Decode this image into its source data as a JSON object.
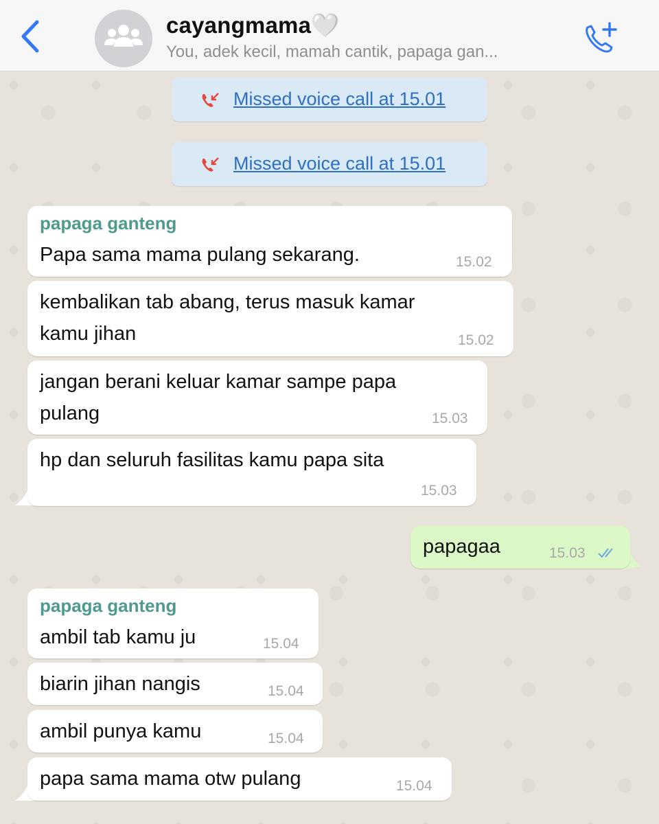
{
  "header": {
    "back_icon": "chevron-left-icon",
    "avatar_icon": "group-icon",
    "title": "cayangmama",
    "title_emoji": "🤍",
    "subtitle": "You, adek kecil, mamah cantik, papaga gan...",
    "call_icon": "add-call-icon"
  },
  "system_messages": [
    {
      "icon": "missed-call-icon",
      "text": "Missed voice call at 15.01"
    },
    {
      "icon": "missed-call-icon",
      "text": "Missed voice call at 15.01"
    }
  ],
  "messages": [
    {
      "sender": "papaga ganteng",
      "lines": [
        "Papa sama mama pulang sekarang."
      ],
      "time": "15.02"
    },
    {
      "lines": [
        "kembalikan tab abang, terus masuk kamar",
        "kamu jihan"
      ],
      "time": "15.02"
    },
    {
      "lines": [
        "jangan berani keluar kamar sampe papa",
        "pulang"
      ],
      "time": "15.03"
    },
    {
      "lines": [
        "hp dan seluruh fasilitas kamu papa sita"
      ],
      "time": "15.03"
    },
    {
      "lines": [
        "papagaa"
      ],
      "time": "15.03",
      "outgoing": true,
      "status_icon": "double-check-icon"
    },
    {
      "sender": "papaga ganteng",
      "lines": [
        "ambil tab kamu ju"
      ],
      "time": "15.04"
    },
    {
      "lines": [
        "biarin jihan nangis"
      ],
      "time": "15.04"
    },
    {
      "lines": [
        "ambil punya kamu"
      ],
      "time": "15.04"
    },
    {
      "lines": [
        "papa sama mama otw pulang"
      ],
      "time": "15.04"
    }
  ],
  "colors": {
    "accent": "#3478f6",
    "sender": "#4f9a8e",
    "outgoing_bubble": "#dcf8c6",
    "system_bubble": "#d9eaf6",
    "missed_call": "#e5483d"
  }
}
